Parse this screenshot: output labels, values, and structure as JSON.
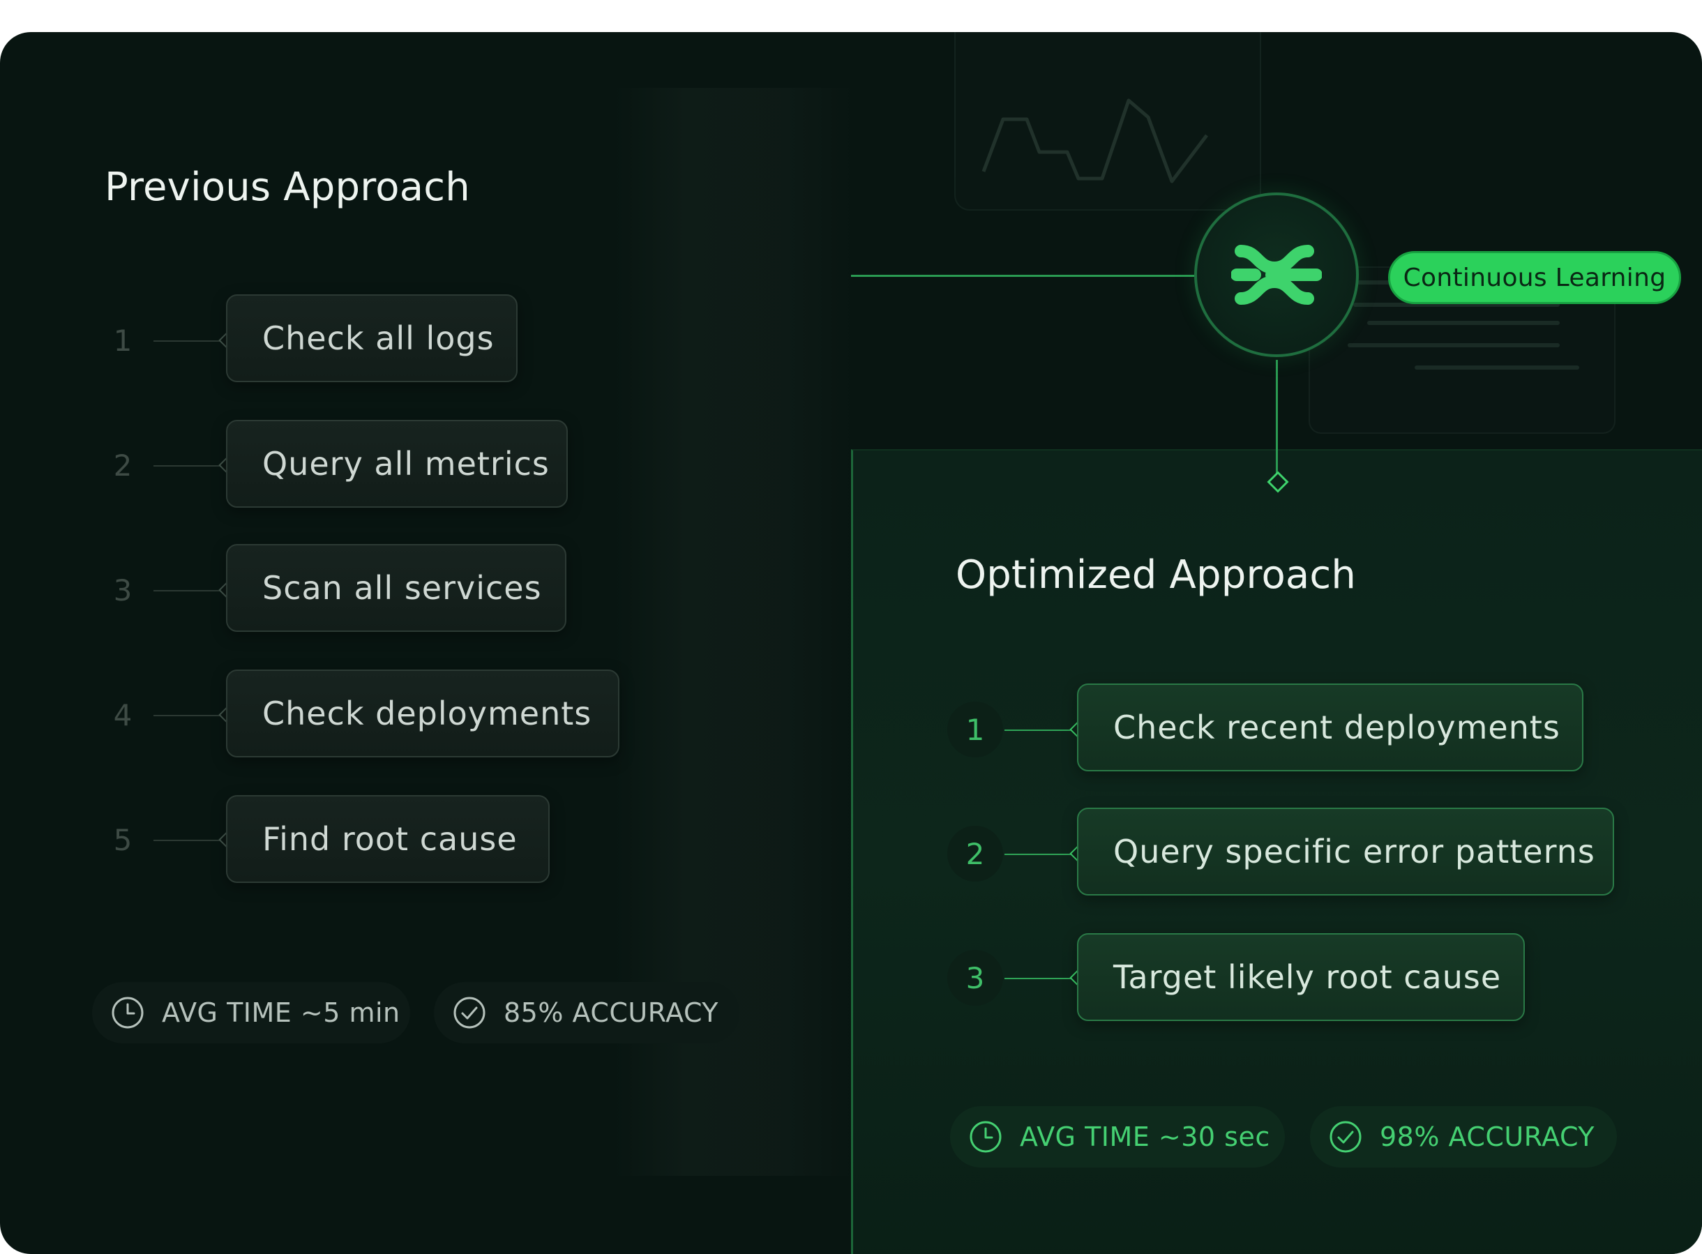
{
  "previous": {
    "title": "Previous Approach",
    "steps": [
      {
        "num": "1",
        "label": "Check all logs"
      },
      {
        "num": "2",
        "label": "Query all metrics"
      },
      {
        "num": "3",
        "label": "Scan all services"
      },
      {
        "num": "4",
        "label": "Check deployments"
      },
      {
        "num": "5",
        "label": "Find root cause"
      }
    ],
    "stats": {
      "time": "AVG TIME ~5 min",
      "accuracy": "85% ACCURACY"
    }
  },
  "optimized": {
    "title": "Optimized Approach",
    "steps": [
      {
        "num": "1",
        "label": "Check recent deployments"
      },
      {
        "num": "2",
        "label": "Query specific error patterns"
      },
      {
        "num": "3",
        "label": "Target likely root cause"
      }
    ],
    "stats": {
      "time": "AVG TIME ~30 sec",
      "accuracy": "98% ACCURACY"
    }
  },
  "hub": {
    "badge": "Continuous Learning",
    "icon": "logo-icon"
  },
  "colors": {
    "background": "#081511",
    "accent": "#2bd15b",
    "accent_text": "#45d072",
    "prev_text": "#cfd8d3",
    "opt_panel": "#0d261b"
  },
  "icons": {
    "time": "clock-icon",
    "accuracy": "check-circle-icon"
  }
}
